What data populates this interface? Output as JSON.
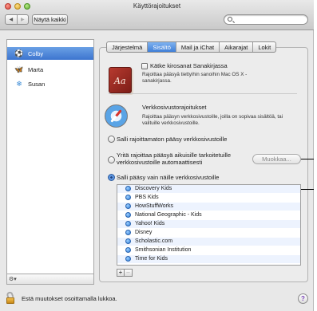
{
  "window": {
    "title": "Käyttörajoitukset"
  },
  "toolbar": {
    "back_glyph": "◀",
    "forward_glyph": "▶",
    "show_all_label": "Näytä kaikki",
    "search_placeholder": ""
  },
  "users": [
    {
      "name": "Colby",
      "icon": "soccer-ball-icon",
      "glyph": "⚽",
      "selected": true
    },
    {
      "name": "Marta",
      "icon": "butterfly-icon",
      "glyph": "🦋",
      "selected": false
    },
    {
      "name": "Susan",
      "icon": "snowflake-icon",
      "glyph": "❄",
      "selected": false
    }
  ],
  "list_footer": {
    "gear_glyph": "⚙▾"
  },
  "tabs": [
    {
      "label": "Järjestelmä",
      "active": false
    },
    {
      "label": "Sisältö",
      "active": true
    },
    {
      "label": "Mail ja iChat",
      "active": false
    },
    {
      "label": "Aikarajat",
      "active": false
    },
    {
      "label": "Lokit",
      "active": false
    }
  ],
  "dictionary": {
    "icon_glyph": "Aa",
    "checkbox_label": "Kätke kirosanat Sanakirjassa",
    "description": "Rajoittaa pääsyä tiettyihin sanoihin Mac OS X -sanakirjassa.",
    "checked": false
  },
  "website_restrictions": {
    "title": "Verkkosivustorajoitukset",
    "description": "Rajoittaa pääsyn verkkosivustoille, joilla on sopivaa sisältöä, tai valituille verkkosivustoille.",
    "options": [
      {
        "label": "Salli rajoittamaton pääsy verkkosivustoille",
        "selected": false
      },
      {
        "label": "Yritä rajoittaa pääsyä aikuisille tarkoitetuille verkkosivustoille automaattisesti",
        "selected": false
      },
      {
        "label": "Salli pääsy vain näille verkkosivustoille",
        "selected": true
      }
    ],
    "customize_label": "Muokkaa...",
    "sites": [
      "Discovery Kids",
      "PBS Kids",
      "HowStuffWorks",
      "National Geographic - Kids",
      "Yahoo! Kids",
      "Disney",
      "Scholastic.com",
      "Smithsonian Institution",
      "Time for Kids"
    ],
    "add_label": "+",
    "remove_label": "–"
  },
  "footer": {
    "lock_text": "Estä muutokset osoittamalla lukkoa.",
    "help_glyph": "?"
  }
}
